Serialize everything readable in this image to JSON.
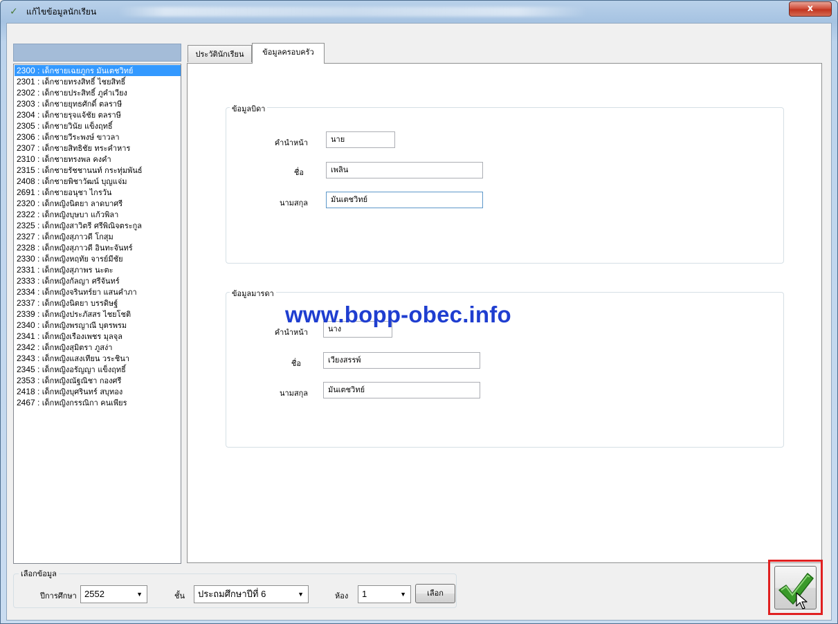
{
  "window": {
    "title": "แก้ไขข้อมูลนักเรียน",
    "close_label": "x",
    "title_icon": "check-icon"
  },
  "students": [
    {
      "code": "2300",
      "name": "เด็กชายเฉยภูกร มันเตชวิทย์",
      "selected": true
    },
    {
      "code": "2301",
      "name": "เด็กชายทรงสิทธิ์ ไชยสิทธิ์"
    },
    {
      "code": "2302",
      "name": "เด็กชายประสิทธิ์ ภูคำเวียง"
    },
    {
      "code": "2303",
      "name": "เด็กชายยุทธศักดิ์ ตลราษี"
    },
    {
      "code": "2304",
      "name": "เด็กชายรุจแจ้ชัย ตลราษี"
    },
    {
      "code": "2305",
      "name": "เด็กชายวินัย แข็งฤทธิ์"
    },
    {
      "code": "2306",
      "name": "เด็กชายวีระพงษ์ ขาวลา"
    },
    {
      "code": "2307",
      "name": "เด็กชายสิทธิชัย ทระคำหาร"
    },
    {
      "code": "2310",
      "name": "เด็กชายทรงพล คงคำ"
    },
    {
      "code": "2315",
      "name": "เด็กชายรัชชานนท์ กระทุ่มพันธ์"
    },
    {
      "code": "2408",
      "name": "เด็กชายพิชาวัฒน์ บุญแจ่ม"
    },
    {
      "code": "2691",
      "name": "เด็กชายอนุชา ไกรวัน"
    },
    {
      "code": "2320",
      "name": "เด็กหญิงนิตยา ลาดบาศรี"
    },
    {
      "code": "2322",
      "name": "เด็กหญิงบุษบา แก้วพิลา"
    },
    {
      "code": "2325",
      "name": "เด็กหญิงสาวิตรี ศรีพิณิจตระกูล"
    },
    {
      "code": "2327",
      "name": "เด็กหญิงสุภาวดี โกสุม"
    },
    {
      "code": "2328",
      "name": "เด็กหญิงสุภาวดี อินทะจันทร์"
    },
    {
      "code": "2330",
      "name": "เด็กหญิงหฤทัย จารย์มีชัย"
    },
    {
      "code": "2331",
      "name": "เด็กหญิงสุภาพร นะตะ"
    },
    {
      "code": "2333",
      "name": "เด็กหญิงกัลญา ศรีจันทร์"
    },
    {
      "code": "2334",
      "name": "เด็กหญิงจรินทร์ยา แสนคำภา"
    },
    {
      "code": "2337",
      "name": "เด็กหญิงนิตยา บรรดิษฐ์"
    },
    {
      "code": "2339",
      "name": "เด็กหญิงประภัสสร ไชยโชติ"
    },
    {
      "code": "2340",
      "name": "เด็กหญิงพรญาณี บุตรพรม"
    },
    {
      "code": "2341",
      "name": "เด็กหญิงเรืองเพชร มุลจุล"
    },
    {
      "code": "2342",
      "name": "เด็กหญิงสุมิตรา ภูสง่า"
    },
    {
      "code": "2343",
      "name": "เด็กหญิงแสงเทียน วระชินา"
    },
    {
      "code": "2345",
      "name": "เด็กหญิงอรัญญา แข็งฤทธิ์"
    },
    {
      "code": "2353",
      "name": "เด็กหญิงณัฐณิชา กองศรี"
    },
    {
      "code": "2418",
      "name": "เด็กหญิงบุศรินทร์ สบุทอง"
    },
    {
      "code": "2467",
      "name": "เด็กหญิงกรรณิกา คนเพียร"
    }
  ],
  "tabs": [
    {
      "label": "ประวัตินักเรียน",
      "active": false
    },
    {
      "label": "ข้อมูลครอบครัว",
      "active": true
    }
  ],
  "father": {
    "title": "ข้อมูลบิดา",
    "prefix_label": "คำนำหน้า",
    "prefix_value": "นาย",
    "name_label": "ชื่อ",
    "name_value": "เพลิน",
    "surname_label": "นามสกุล",
    "surname_value": "มันเตชวิทย์"
  },
  "mother": {
    "title": "ข้อมูลมารดา",
    "prefix_label": "คำนำหน้า",
    "prefix_value": "นาง",
    "name_label": "ชื่อ",
    "name_value": "เวียงสรรพ์",
    "surname_label": "นามสกุล",
    "surname_value": "มันเตชวิทย์"
  },
  "watermark": "www.bopp-obec.info",
  "selection": {
    "title": "เลือกข้อมูล",
    "year_label": "ปีการศึกษา",
    "year_value": "2552",
    "grade_label": "ชั้น",
    "grade_value": "ประถมศึกษาปีที่ 6",
    "room_label": "ห้อง",
    "room_value": "1",
    "select_button": "เลือก"
  },
  "ok_button_icon": "checkmark-icon",
  "colors": {
    "selected_row": "#3399ff",
    "list_header": "#a4bcd8",
    "watermark": "#1f3ed0",
    "highlight": "#e02020",
    "check_green": "#3a9a2a"
  }
}
